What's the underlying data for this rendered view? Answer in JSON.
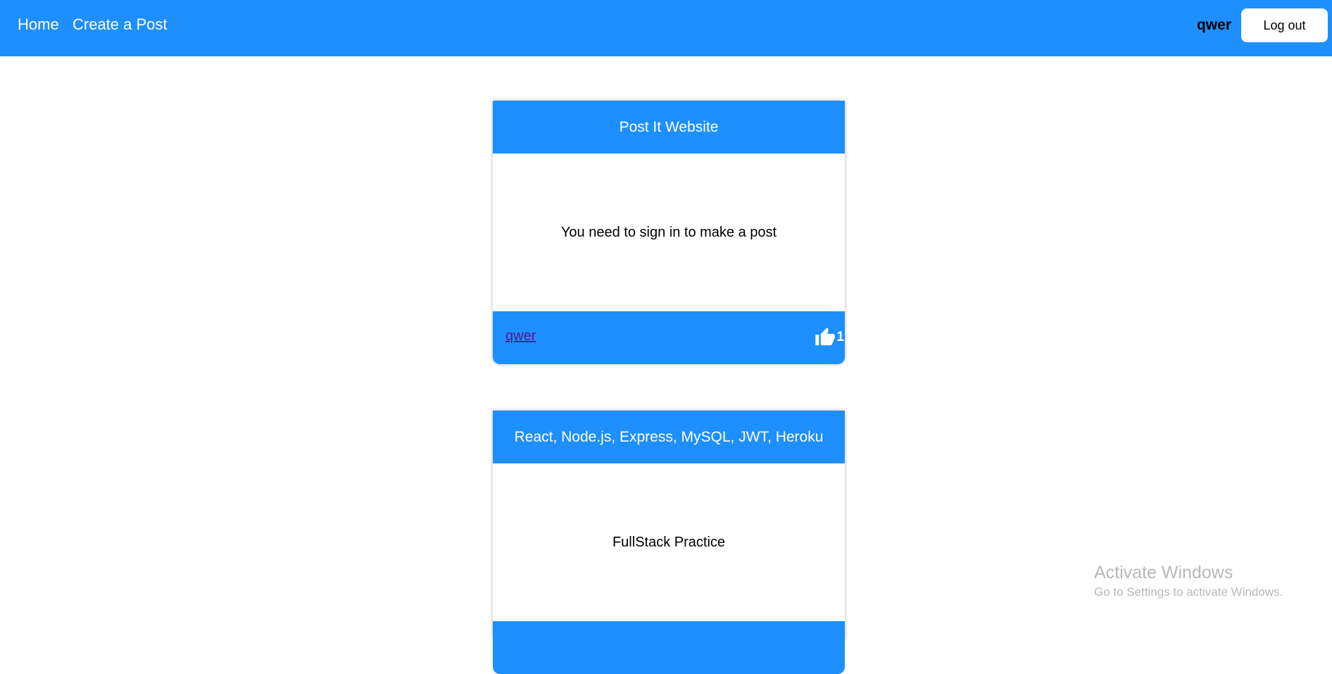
{
  "navbar": {
    "links": [
      "Home",
      "Create a Post"
    ],
    "username": "qwer",
    "logout_label": "Log out",
    "background": "#1e8fff"
  },
  "posts": [
    {
      "title": "Post It Website",
      "body": "You need to sign in to make a post",
      "author": "qwer",
      "likes": "1",
      "like_icon": "thumbs-up-icon"
    },
    {
      "title": "React, Node.js, Express, MySQL, JWT, Heroku",
      "body": "FullStack Practice"
    }
  ],
  "watermark": {
    "title": "Activate Windows",
    "subtitle": "Go to Settings to activate Windows."
  }
}
